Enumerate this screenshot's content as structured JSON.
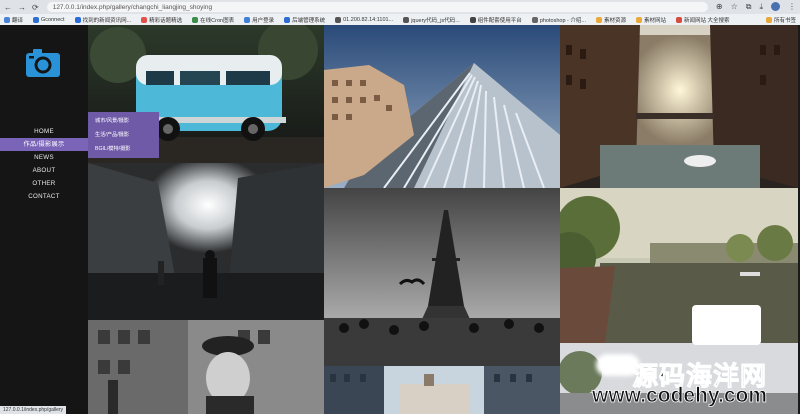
{
  "browser": {
    "address": "127.0.0.1/index.php/gallery/changchi_liangjing_shoying",
    "bookmarks": [
      "翻译",
      "Gconnect",
      "找到的新闻资讯网...",
      "精彩话题精选",
      "在线Cron图表",
      "用户登录",
      "后端管理系统",
      "01.200.82.14:1101...",
      "jquery代码_js代码...",
      "组件配套使用平台",
      "photoshop - 介绍...",
      "素材资源",
      "素材网站",
      "新闻网站 大全搜索"
    ],
    "all_bookmarks": "所有书签"
  },
  "menu": {
    "items": [
      "HOME",
      "作品/摄影展示",
      "NEWS",
      "ABOUT",
      "OTHER",
      "CONTACT"
    ],
    "active_index": 1,
    "submenu": [
      "城市/风景/摄影",
      "生活/产品/摄影",
      "BGIL/模特/摄影"
    ]
  },
  "status_bar": {
    "url": "127.0.0.1/index.php/gallery"
  },
  "watermark": {
    "title": "源码海洋网",
    "url": "www.codehy.com"
  },
  "colors": {
    "menu_active": "#7a64b8",
    "submenu_bg": "#6f5aa8",
    "sidebar_bg": "#151515"
  }
}
